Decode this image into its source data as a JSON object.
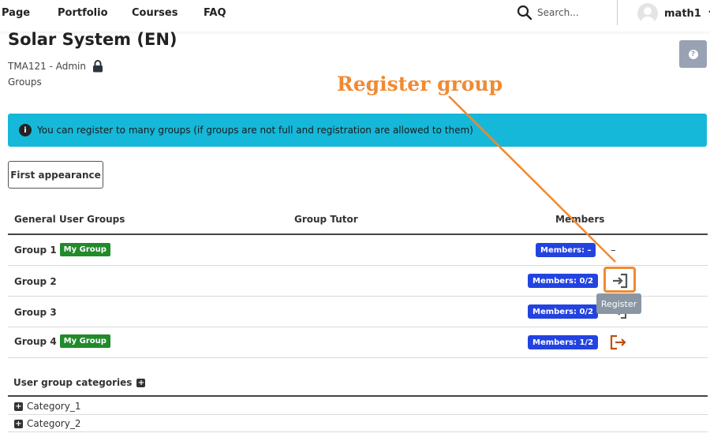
{
  "nav": {
    "links": [
      "Page",
      "Portfolio",
      "Courses",
      "FAQ"
    ],
    "search_placeholder": "Search...",
    "user_name": "math1"
  },
  "header": {
    "title": "Solar System (EN)",
    "course_code": "TMA121 - Admin",
    "breadcrumb": "Groups"
  },
  "annotation": {
    "label": "Register group",
    "color": "#f08a32"
  },
  "alert": {
    "text": "You can register to many groups (if groups are not full and registration are allowed to them)",
    "background": "#15b8d9"
  },
  "toolbar": {
    "first_appearance_label": "First appearance"
  },
  "table": {
    "headers": [
      "General User Groups",
      "Group Tutor",
      "Members"
    ],
    "rows": [
      {
        "name": "Group 1",
        "badge": "My Group",
        "members": "Members: –",
        "action": "–"
      },
      {
        "name": "Group 2",
        "badge": "",
        "members": "Members: 0/2",
        "action": "register"
      },
      {
        "name": "Group 3",
        "badge": "",
        "members": "Members: 0/2",
        "action": "register"
      },
      {
        "name": "Group 4",
        "badge": "My Group",
        "members": "Members: 1/2",
        "action": "unregister"
      }
    ]
  },
  "tooltip": "Register",
  "categories": {
    "title": "User group categories",
    "items": [
      "Category_1",
      "Category_2"
    ]
  },
  "colors": {
    "badge_green": "#218a2b",
    "badge_blue": "#2343e0",
    "unregister": "#c24e0e"
  }
}
